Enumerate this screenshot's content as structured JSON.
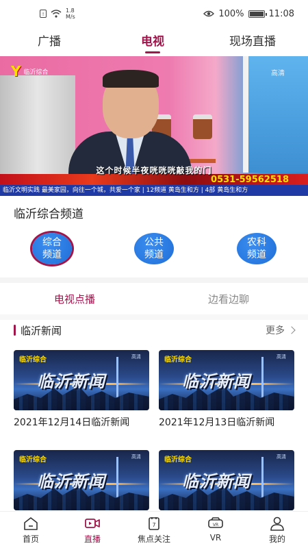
{
  "status_bar": {
    "speed_value": "1.8",
    "speed_unit": "M/s",
    "battery": "100%",
    "battery_level": 1.0,
    "time": "11:08"
  },
  "top_tabs": [
    {
      "label": "广播",
      "active": false
    },
    {
      "label": "电视",
      "active": true
    },
    {
      "label": "现场直播",
      "active": false
    }
  ],
  "video": {
    "channel_logo_text": "临沂综合",
    "hd_tag": "高清",
    "subtitle": "这个时候半夜咣咣咣敲我的门",
    "ad_phone": "0531-59562518",
    "ticker": "临沂文明实践 最美家园，向往一个城，共爱一个家 | 12频道 黄岛生和方 | 4部 黄岛生和方"
  },
  "channel_section": {
    "title": "临沂综合频道",
    "channels": [
      {
        "label": "综合频道",
        "selected": true
      },
      {
        "label": "公共频道",
        "selected": false
      },
      {
        "label": "农科频道",
        "selected": false
      }
    ]
  },
  "vod_tabs": [
    {
      "label": "电视点播",
      "active": true
    },
    {
      "label": "边看边聊",
      "active": false
    }
  ],
  "news_section": {
    "title": "临沂新闻",
    "more_label": "更多",
    "thumb_headline": "临沂新闻",
    "thumb_logo": "临沂综合",
    "thumb_hd": "高清",
    "cards": [
      {
        "title": "2021年12月14日临沂新闻"
      },
      {
        "title": "2021年12月13日临沂新闻"
      },
      {
        "title": ""
      },
      {
        "title": ""
      }
    ]
  },
  "bottom_nav": [
    {
      "label": "首页",
      "icon": "home-icon",
      "active": false
    },
    {
      "label": "直播",
      "icon": "video-camera-icon",
      "active": true
    },
    {
      "label": "焦点关注",
      "icon": "focus-icon",
      "active": false
    },
    {
      "label": "VR",
      "icon": "vr-headset-icon",
      "active": false
    },
    {
      "label": "我的",
      "icon": "user-icon",
      "active": false
    }
  ],
  "colors": {
    "accent": "#a0154a",
    "channel_button": "#1f6ed8"
  }
}
